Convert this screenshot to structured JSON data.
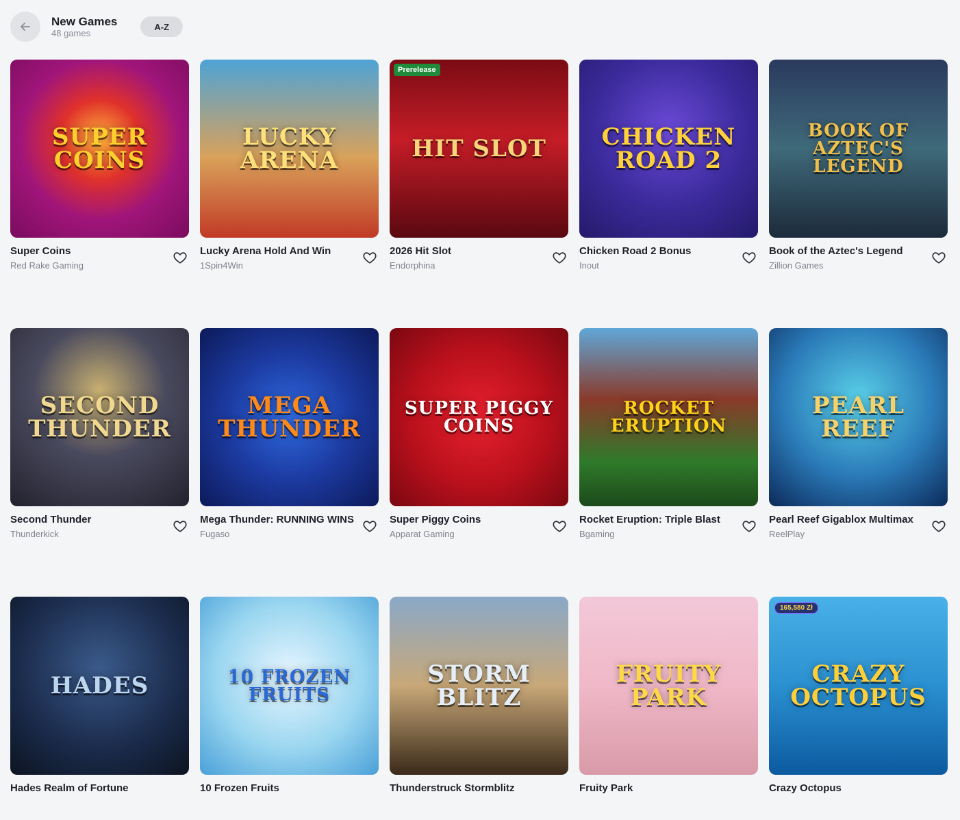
{
  "header": {
    "title": "New Games",
    "subtitle": "48 games",
    "sort_label": "A-Z"
  },
  "games": [
    {
      "name": "Super Coins",
      "provider": "Red Rake Gaming",
      "logo": "SUPER COINS",
      "logo_color": "#ffcf2e"
    },
    {
      "name": "Lucky Arena Hold And Win",
      "provider": "1Spin4Win",
      "logo": "LUCKY ARENA",
      "logo_color": "#ffe07a"
    },
    {
      "name": "2026 Hit Slot",
      "provider": "Endorphina",
      "logo": "HIT SLOT",
      "logo_color": "#f7d57a",
      "badge": "Prerelease"
    },
    {
      "name": "Chicken Road 2 Bonus",
      "provider": "Inout",
      "logo": "CHICKEN ROAD 2",
      "logo_color": "#ffd23a"
    },
    {
      "name": "Book of the Aztec's Legend",
      "provider": "Zillion Games",
      "logo": "BOOK OF AZTEC'S LEGEND",
      "logo_color": "#f2c04a"
    },
    {
      "name": "Second Thunder",
      "provider": "Thunderkick",
      "logo": "SECOND THUNDER",
      "logo_color": "#f0d890"
    },
    {
      "name": "Mega Thunder: RUNNING WINS",
      "provider": "Fugaso",
      "logo": "MEGA THUNDER",
      "logo_color": "#ff8a1a"
    },
    {
      "name": "Super Piggy Coins",
      "provider": "Apparat Gaming",
      "logo": "SUPER PIGGY COINS",
      "logo_color": "#ffffff"
    },
    {
      "name": "Rocket Eruption: Triple Blast",
      "provider": "Bgaming",
      "logo": "ROCKET ERUPTION",
      "logo_color": "#ffd21a"
    },
    {
      "name": "Pearl Reef Gigablox Multimax",
      "provider": "ReelPlay",
      "logo": "PEARL REEF",
      "logo_color": "#f7d26a"
    },
    {
      "name": "Hades Realm of Fortune",
      "provider": "",
      "logo": "HADES",
      "logo_color": "#bcd6f0"
    },
    {
      "name": "10 Frozen Fruits",
      "provider": "",
      "logo": "10 FROZEN FRUITS",
      "logo_color": "#2a6ad8"
    },
    {
      "name": "Thunderstruck Stormblitz",
      "provider": "",
      "logo": "STORM BLITZ",
      "logo_color": "#e6eef8"
    },
    {
      "name": "Fruity Park",
      "provider": "",
      "logo": "FRUITY PARK",
      "logo_color": "#ffd84a"
    },
    {
      "name": "Crazy Octopus",
      "provider": "",
      "logo": "CRAZY OCTOPUS",
      "logo_color": "#ffcf3a",
      "jackpot": "165,580 Zł"
    }
  ]
}
